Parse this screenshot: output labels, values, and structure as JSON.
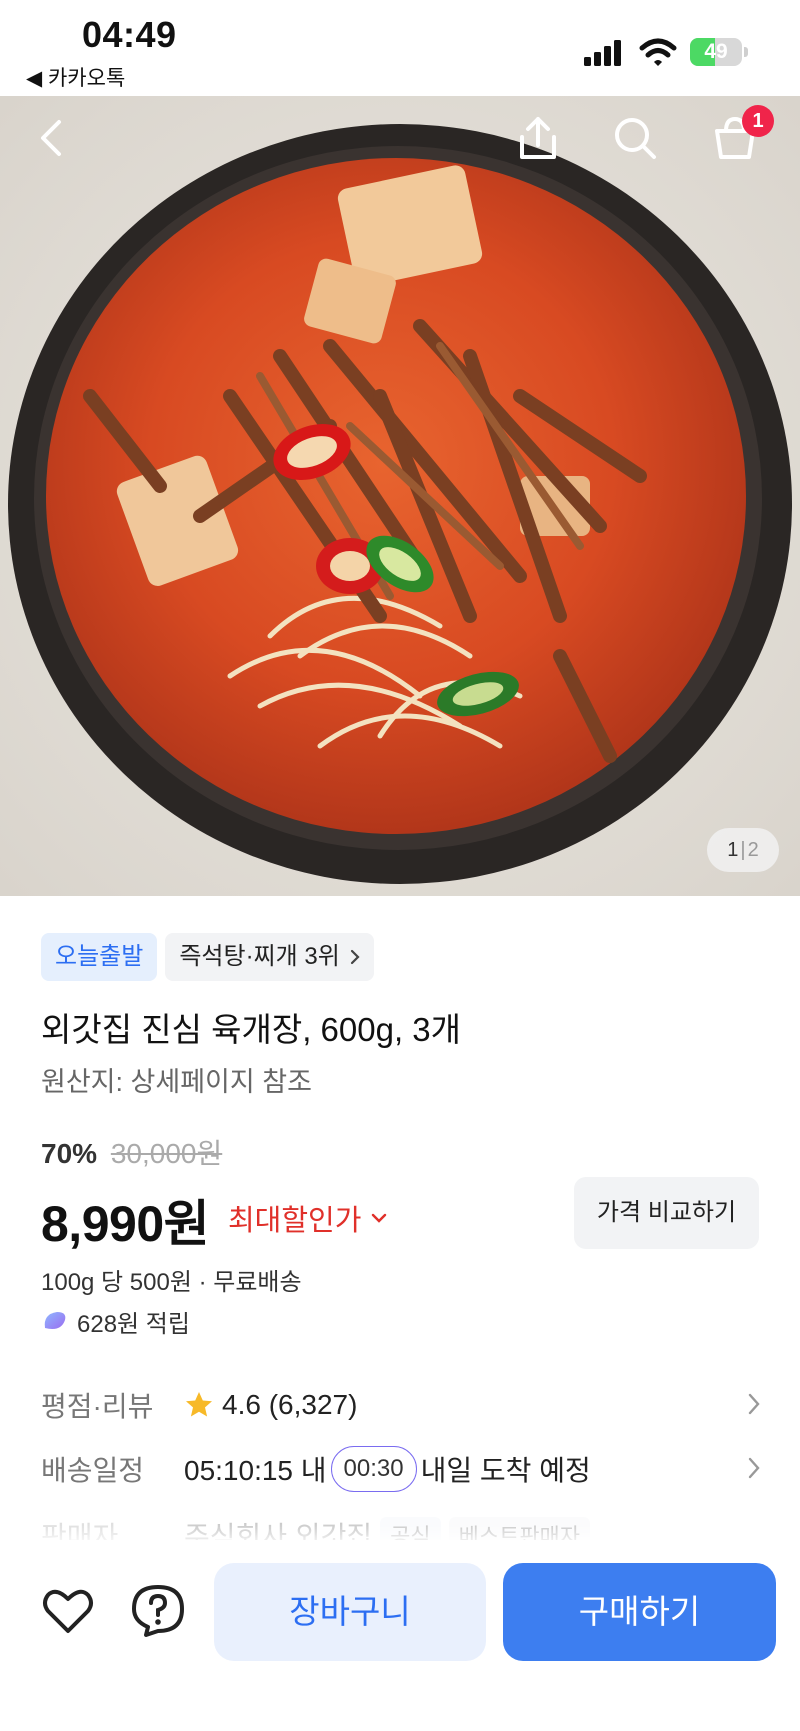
{
  "status_bar": {
    "time": "04:49",
    "back_app_label": "◀ 카카오톡",
    "battery_level": "49",
    "battery_fraction": 0.49
  },
  "hero": {
    "cart_badge_count": "1",
    "page_current": "1",
    "page_separator": "|",
    "page_total": "2"
  },
  "product": {
    "badge_today": "오늘출발",
    "badge_rank": "즉석탕·찌개 3위",
    "title": "외갓집 진심 육개장, 600g, 3개",
    "origin": "원산지: 상세페이지 참조",
    "discount_rate": "70%",
    "original_price": "30,000원",
    "price": "8,990원",
    "max_discount_label": "최대할인가",
    "compare_label": "가격 비교하기",
    "unit_price": "100g 당 500원 · 무료배송",
    "points": "628원 적립"
  },
  "details": {
    "rating_label": "평점·리뷰",
    "rating_value": "4.6 (6,327)",
    "delivery_label": "배송일정",
    "delivery_countdown": "05:10:15 내",
    "delivery_timer": "00:30",
    "delivery_eta": "내일 도착 예정",
    "seller_label": "판매자",
    "seller_value": "주식회사 외갓집",
    "seller_badge_official": "공식",
    "seller_badge_best": "베스트판매자"
  },
  "bottom_bar": {
    "cart_label": "장바구니",
    "buy_label": "구매하기"
  },
  "colors": {
    "primary_blue": "#3d7ef0",
    "discount_red": "#e0302a",
    "badge_red": "#f0244a",
    "battery_green": "#4cd964"
  },
  "icons": [
    "back-arrow-icon",
    "share-icon",
    "search-icon",
    "cart-icon",
    "chevron-right-icon",
    "chevron-down-icon",
    "star-icon",
    "points-icon",
    "heart-icon",
    "help-icon"
  ]
}
